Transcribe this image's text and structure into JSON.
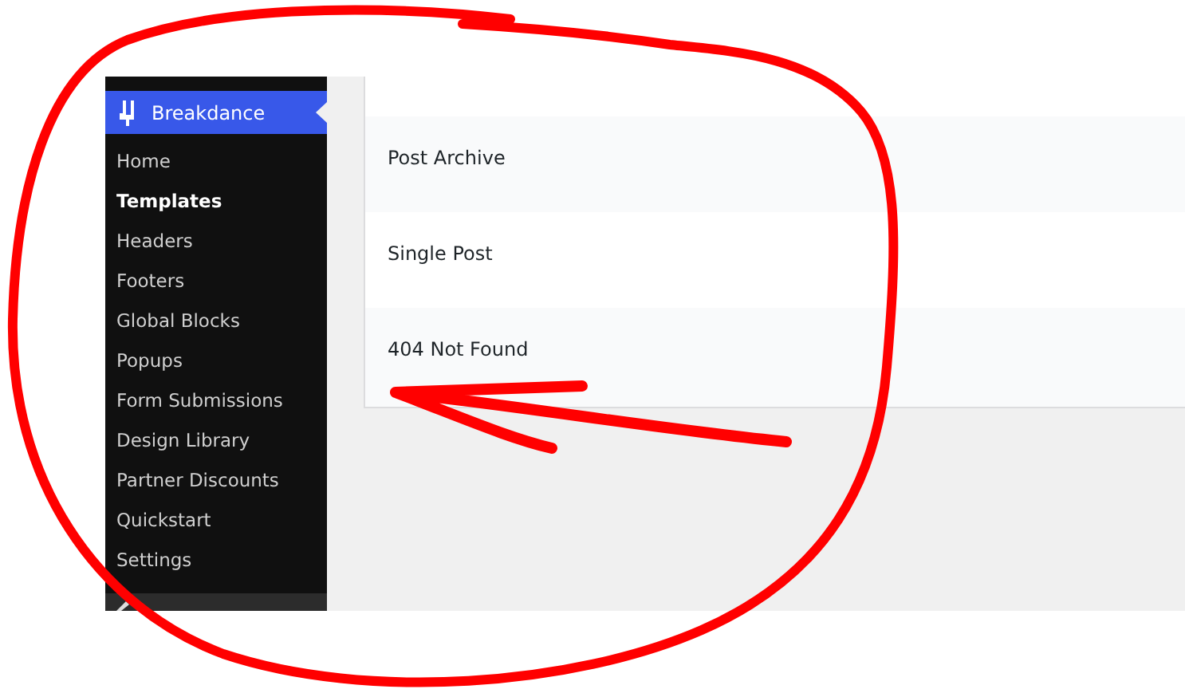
{
  "sidebar": {
    "header": {
      "label": "Breakdance",
      "selected": true
    },
    "items": [
      {
        "label": "Home",
        "selected": false
      },
      {
        "label": "Templates",
        "selected": true
      },
      {
        "label": "Headers",
        "selected": false
      },
      {
        "label": "Footers",
        "selected": false
      },
      {
        "label": "Global Blocks",
        "selected": false
      },
      {
        "label": "Popups",
        "selected": false
      },
      {
        "label": "Form Submissions",
        "selected": false
      },
      {
        "label": "Design Library",
        "selected": false
      },
      {
        "label": "Partner Discounts",
        "selected": false
      },
      {
        "label": "Quickstart",
        "selected": false
      },
      {
        "label": "Settings",
        "selected": false
      }
    ]
  },
  "templates": {
    "rows": [
      {
        "label": "Post Archive"
      },
      {
        "label": "Single Post"
      },
      {
        "label": "404 Not Found"
      }
    ]
  }
}
